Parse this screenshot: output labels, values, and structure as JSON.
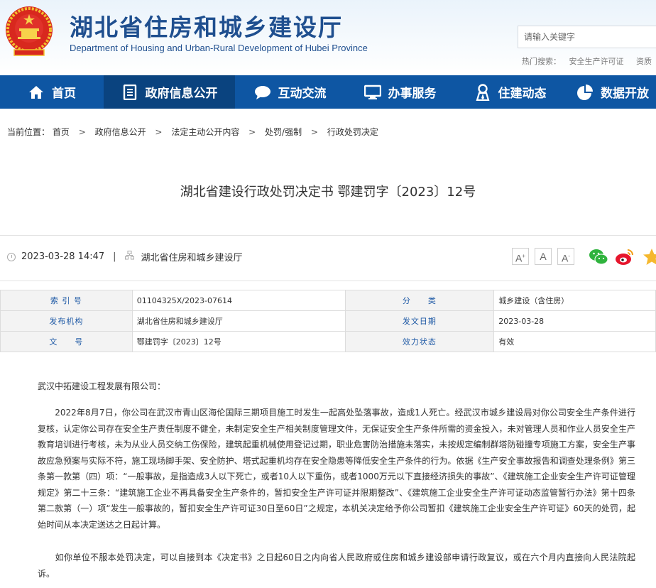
{
  "header": {
    "title": "湖北省住房和城乡建设厅",
    "subtitle": "Department of Housing and Urban-Rural Development of Hubei Province",
    "search_placeholder": "请输入关键字",
    "hot_label": "热门搜索：",
    "hot_items": [
      "安全生产许可证",
      "资质"
    ]
  },
  "nav": {
    "items": [
      {
        "label": "首页",
        "icon": "home-icon"
      },
      {
        "label": "政府信息公开",
        "icon": "document-list-icon"
      },
      {
        "label": "互动交流",
        "icon": "chat-bubble-icon"
      },
      {
        "label": "办事服务",
        "icon": "monitor-icon"
      },
      {
        "label": "住建动态",
        "icon": "person-icon"
      },
      {
        "label": "数据开放",
        "icon": "pie-chart-icon"
      }
    ],
    "active_index": 1,
    "colors": {
      "bar": "#0e56a3",
      "active": "#0a437f"
    }
  },
  "breadcrumb": {
    "label": "当前位置：",
    "items": [
      "首页",
      "政府信息公开",
      "法定主动公开内容",
      "处罚/强制",
      "行政处罚决定"
    ],
    "separator": ">"
  },
  "article": {
    "title": "湖北省建设行政处罚决定书 鄂建罚字〔2023〕12号",
    "datetime": "2023-03-28 14:47",
    "source": "湖北省住房和城乡建设厅",
    "font_buttons": [
      "A+",
      "A",
      "A-"
    ],
    "share_icons": [
      "wechat-icon",
      "weibo-icon",
      "star-icon"
    ]
  },
  "info_table": {
    "rows": [
      {
        "label1": "索 引 号",
        "value1": "01104325X/2023-07614",
        "label2": "分　　类",
        "value2": "城乡建设（含住房）"
      },
      {
        "label1": "发布机构",
        "value1": "湖北省住房和城乡建设厅",
        "label2": "发文日期",
        "value2": "2023-03-28"
      },
      {
        "label1": "文　　号",
        "value1": "鄂建罚字〔2023〕12号",
        "label2": "效力状态",
        "value2": "有效"
      }
    ]
  },
  "content": {
    "recipient": "武汉中拓建设工程发展有限公司：",
    "para1": "　　2022年8月7日，你公司在武汉市青山区海伦国际三期项目施工时发生一起高处坠落事故，造成1人死亡。经武汉市城乡建设局对你公司安全生产条件进行复核，认定你公司存在安全生产责任制度不健全，未制定安全生产相关制度管理文件，无保证安全生产条件所需的资金投入，未对管理人员和作业人员安全生产教育培训进行考核，未为从业人员交纳工伤保险，建筑起重机械使用登记过期，职业危害防治措施未落实，未按规定编制群塔防碰撞专项施工方案，安全生产事故应急预案与实际不符，施工现场脚手架、安全防护、塔式起重机均存在安全隐患等降低安全生产条件的行为。依据《生产安全事故报告和调查处理条例》第三条第一款第（四）项：“一般事故，是指造成3人以下死亡，或者10人以下重伤，或者1000万元以下直接经济损失的事故”、《建筑施工企业安全生产许可证管理规定》第二十三条：“建筑施工企业不再具备安全生产条件的，暂扣安全生产许可证并限期整改”、《建筑施工企业安全生产许可证动态监管暂行办法》第十四条第二款第（一）项“发生一般事故的，暂扣安全生产许可证30日至60日”之规定，本机关决定给予你公司暂扣《建筑施工企业安全生产许可证》60天的处罚，起始时间从本决定送达之日起计算。",
    "para2": "　　如你单位不服本处罚决定，可以自接到本《决定书》之日起60日之内向省人民政府或住房和城乡建设部申请行政复议，或在六个月内直接向人民法院起诉。"
  }
}
